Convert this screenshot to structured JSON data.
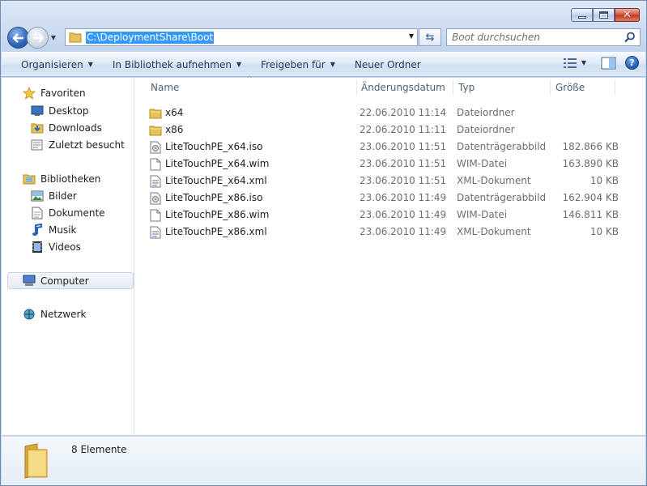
{
  "window": {
    "caption_buttons": [
      "minimize-icon",
      "maximize-icon",
      "close-icon"
    ]
  },
  "address": {
    "path": "C:\\DeploymentShare\\Boot"
  },
  "search": {
    "placeholder": "Boot durchsuchen"
  },
  "toolbar": {
    "organize": "Organisieren",
    "library": "In Bibliothek aufnehmen",
    "share": "Freigeben für",
    "new_folder": "Neuer Ordner"
  },
  "sidebar": {
    "favorites": "Favoriten",
    "desktop": "Desktop",
    "downloads": "Downloads",
    "recent": "Zuletzt besucht",
    "libraries": "Bibliotheken",
    "pictures": "Bilder",
    "documents": "Dokumente",
    "music": "Musik",
    "videos": "Videos",
    "computer": "Computer",
    "network": "Netzwerk"
  },
  "columns": {
    "name": "Name",
    "date": "Änderungsdatum",
    "type": "Typ",
    "size": "Größe"
  },
  "files": [
    {
      "name": "x64",
      "date": "22.06.2010 11:14",
      "type": "Dateiordner",
      "size": "",
      "icon": "folder-icon"
    },
    {
      "name": "x86",
      "date": "22.06.2010 11:11",
      "type": "Dateiordner",
      "size": "",
      "icon": "folder-icon"
    },
    {
      "name": "LiteTouchPE_x64.iso",
      "date": "23.06.2010 11:51",
      "type": "Datenträgerabbild...",
      "size": "182.866 KB",
      "icon": "disc-image-icon"
    },
    {
      "name": "LiteTouchPE_x64.wim",
      "date": "23.06.2010 11:51",
      "type": "WIM-Datei",
      "size": "163.890 KB",
      "icon": "file-icon"
    },
    {
      "name": "LiteTouchPE_x64.xml",
      "date": "23.06.2010 11:51",
      "type": "XML-Dokument",
      "size": "10 KB",
      "icon": "xml-file-icon"
    },
    {
      "name": "LiteTouchPE_x86.iso",
      "date": "23.06.2010 11:49",
      "type": "Datenträgerabbild...",
      "size": "162.904 KB",
      "icon": "disc-image-icon"
    },
    {
      "name": "LiteTouchPE_x86.wim",
      "date": "23.06.2010 11:49",
      "type": "WIM-Datei",
      "size": "146.811 KB",
      "icon": "file-icon"
    },
    {
      "name": "LiteTouchPE_x86.xml",
      "date": "23.06.2010 11:49",
      "type": "XML-Dokument",
      "size": "10 KB",
      "icon": "xml-file-icon"
    }
  ],
  "status": {
    "count": "8 Elemente"
  }
}
